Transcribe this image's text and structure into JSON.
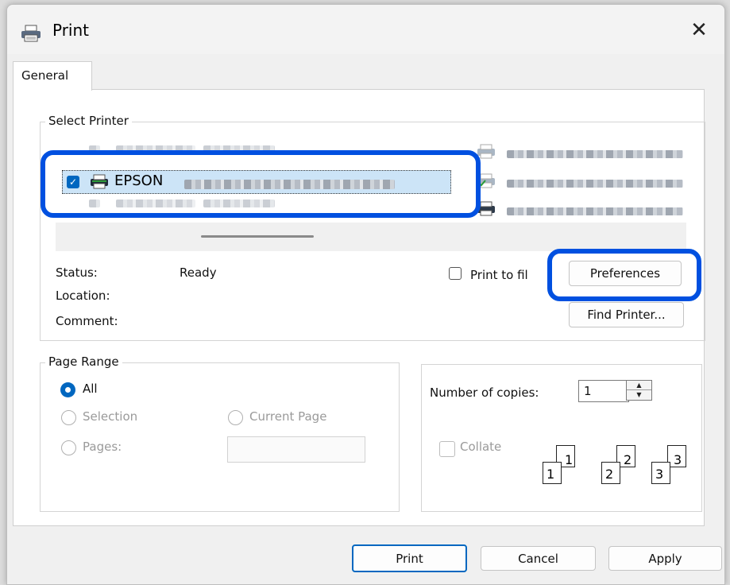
{
  "window": {
    "title": "Print",
    "close_glyph": "✕"
  },
  "tabs": [
    {
      "label": "General"
    }
  ],
  "select_printer": {
    "legend": "Select Printer",
    "selected_printer_visible_text": "EPSON",
    "other_printers_redacted": true
  },
  "status": {
    "status_label": "Status:",
    "status_value": "Ready",
    "location_label": "Location:",
    "comment_label": "Comment:"
  },
  "print_to_file": {
    "label": "Print to fil",
    "checked": false
  },
  "buttons": {
    "preferences": "Preferences",
    "find_printer": "Find Printer...",
    "print": "Print",
    "cancel": "Cancel",
    "apply": "Apply"
  },
  "page_range": {
    "legend": "Page Range",
    "all": "All",
    "selection": "Selection",
    "current_page": "Current Page",
    "pages": "Pages:",
    "selected": "All"
  },
  "copies": {
    "label": "Number of copies:",
    "value": "1",
    "collate_label": "Collate",
    "collate_checked": false,
    "collate_numbers": [
      "1",
      "1",
      "2",
      "2",
      "3",
      "3"
    ]
  },
  "colors": {
    "accent": "#0067c0",
    "highlight": "#0050e0",
    "selection_bg": "#cce4f7"
  },
  "icons": [
    "printer-icon",
    "close-icon",
    "checkbox-checked-icon",
    "spin-up-icon",
    "spin-down-icon",
    "collate-pages-icon"
  ]
}
